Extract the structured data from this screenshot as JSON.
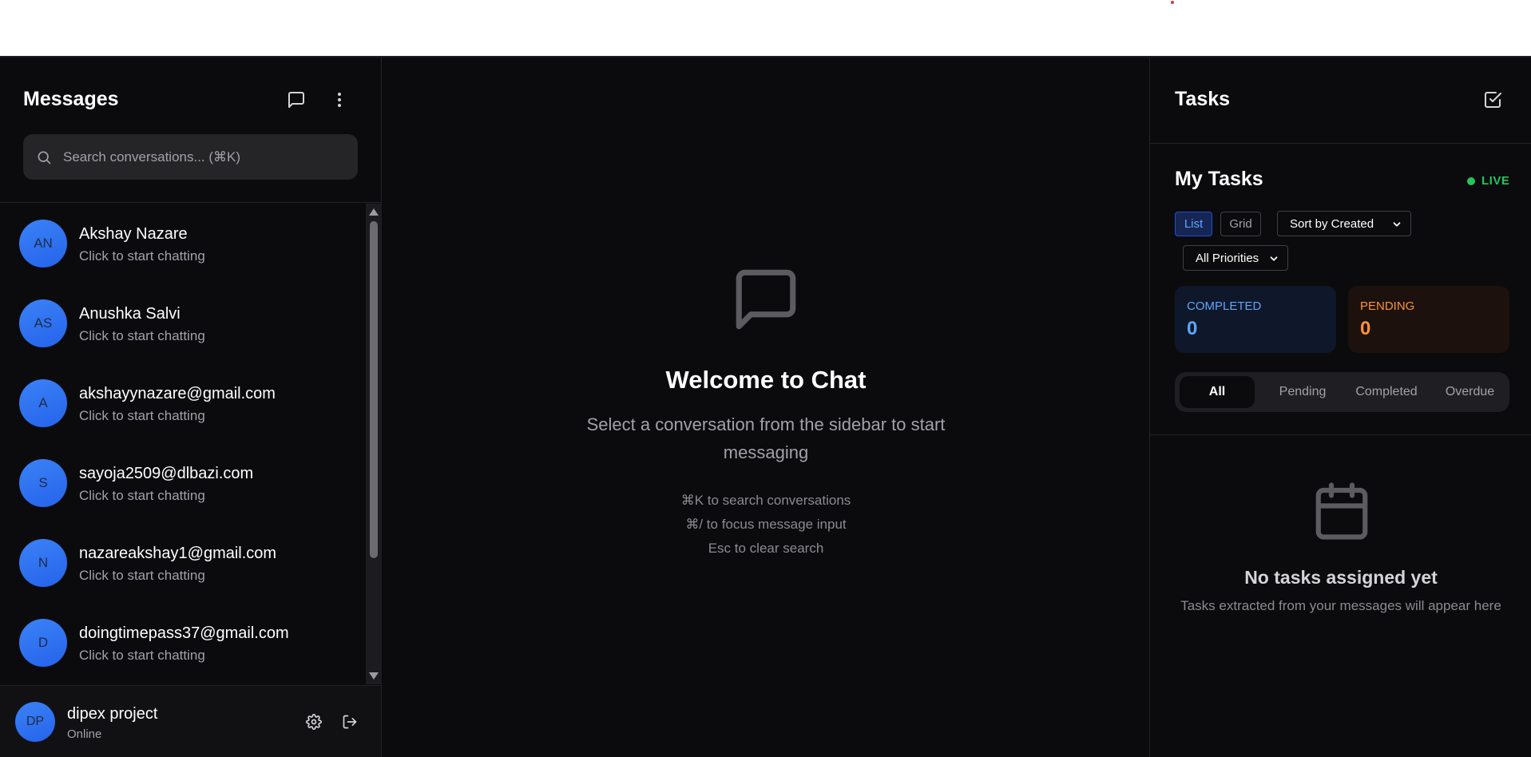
{
  "sidebar": {
    "title": "Messages",
    "search_placeholder": "Search conversations... (⌘K)",
    "conversations": [
      {
        "initials": "AN",
        "name": "Akshay Nazare",
        "subtitle": "Click to start chatting"
      },
      {
        "initials": "AS",
        "name": "Anushka Salvi",
        "subtitle": "Click to start chatting"
      },
      {
        "initials": "A",
        "name": "akshayynazare@gmail.com",
        "subtitle": "Click to start chatting"
      },
      {
        "initials": "S",
        "name": "sayoja2509@dlbazi.com",
        "subtitle": "Click to start chatting"
      },
      {
        "initials": "N",
        "name": "nazareakshay1@gmail.com",
        "subtitle": "Click to start chatting"
      },
      {
        "initials": "D",
        "name": "doingtimepass37@gmail.com",
        "subtitle": "Click to start chatting"
      }
    ],
    "user": {
      "initials": "DP",
      "name": "dipex project",
      "status": "Online"
    }
  },
  "main": {
    "welcome_title": "Welcome to Chat",
    "welcome_subtitle": "Select a conversation from the sidebar to start messaging",
    "hints": [
      "⌘K to search conversations",
      "⌘/ to focus message input",
      "Esc to clear search"
    ]
  },
  "tasks": {
    "title": "Tasks",
    "section_title": "My Tasks",
    "live_label": "LIVE",
    "view_list": "List",
    "view_grid": "Grid",
    "sort_value": "Sort by Created",
    "priority_value": "All Priorities",
    "stats": {
      "completed_label": "COMPLETED",
      "completed_value": "0",
      "pending_label": "PENDING",
      "pending_value": "0"
    },
    "filters": [
      "All",
      "Pending",
      "Completed",
      "Overdue"
    ],
    "active_filter": "All",
    "empty_title": "No tasks assigned yet",
    "empty_subtitle": "Tasks extracted from your messages will appear here"
  },
  "colors": {
    "background": "#0b0b0d",
    "accent": "#3b82f6",
    "live": "#22c55e",
    "pending": "#fb923c"
  },
  "icons": {
    "new_chat": "message-square-icon",
    "more": "more-vertical-icon",
    "search": "search-icon",
    "settings": "gear-icon",
    "logout": "logout-icon",
    "welcome": "message-square-icon",
    "tasks": "check-square-icon",
    "empty": "calendar-icon"
  }
}
